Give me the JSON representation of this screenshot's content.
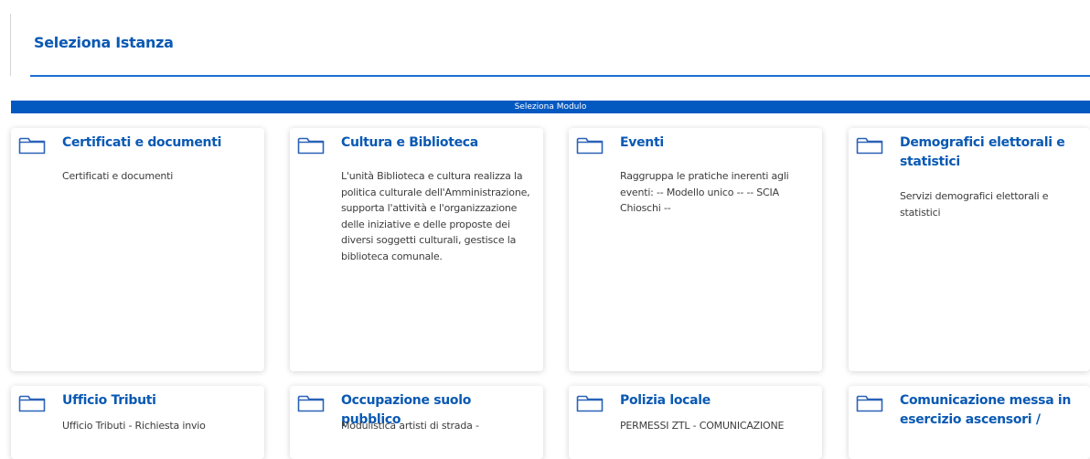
{
  "header": {
    "title": "Seleziona Istanza"
  },
  "module_bar": {
    "label": "Seleziona Modulo"
  },
  "cards": [
    {
      "title": "Certificati e documenti",
      "description": "Certificati e documenti"
    },
    {
      "title": "Cultura e Biblioteca",
      "description": "L'unità Biblioteca e cultura realizza la politica culturale dell'Amministrazione, supporta l'attività e l'organizzazione delle iniziative e delle proposte dei diversi soggetti culturali, gestisce la biblioteca comunale."
    },
    {
      "title": "Eventi",
      "description": "Raggruppa le pratiche inerenti agli eventi: -- Modello unico -- -- SCIA Chioschi --"
    },
    {
      "title": "Demografici elettorali e statistici",
      "description": "Servizi demografici elettorali e statistici"
    },
    {
      "title": "Ufficio Tributi",
      "description": "Ufficio Tributi - Richiesta invio"
    },
    {
      "title": "Occupazione suolo pubblico",
      "description": "Modulistica artisti di strada -"
    },
    {
      "title": "Polizia locale",
      "description": "PERMESSI ZTL - COMUNICAZIONE"
    },
    {
      "title": "Comunicazione messa in esercizio ascensori /",
      "description": ""
    }
  ],
  "colors": {
    "accent": "#0a59b3",
    "bar": "#0459c1",
    "icon": "#2a62b8"
  },
  "icons": {
    "card": "folder-icon"
  }
}
